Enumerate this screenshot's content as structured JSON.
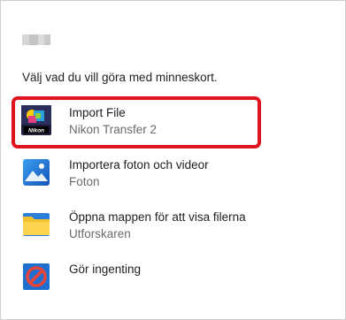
{
  "dialog": {
    "prompt": "Välj vad du vill göra med minneskort."
  },
  "options": [
    {
      "title": "Import File",
      "subtitle": "Nikon Transfer 2",
      "icon": "nikon-transfer-icon",
      "highlighted": true
    },
    {
      "title": "Importera foton och videor",
      "subtitle": "Foton",
      "icon": "photos-icon"
    },
    {
      "title": "Öppna mappen för att visa filerna",
      "subtitle": "Utforskaren",
      "icon": "folder-icon"
    },
    {
      "title": "Gör ingenting",
      "subtitle": "",
      "icon": "no-action-icon"
    }
  ],
  "colors": {
    "highlight": "#e0141e",
    "photos_blue": "#1e74d6",
    "folder_yellow": "#f5c02e"
  }
}
